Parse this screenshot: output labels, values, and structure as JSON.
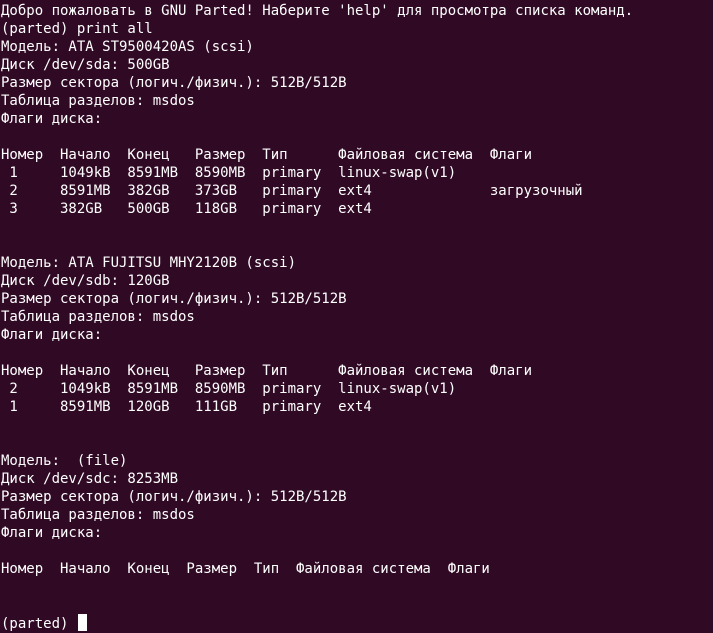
{
  "window": {
    "background": "#300a24",
    "foreground": "#ffffff"
  },
  "terminal": {
    "lines": [
      "Добро пожаловать в GNU Parted! Наберите 'help' для просмотра списка команд.",
      "(parted) print all",
      "Модель: ATA ST9500420AS (scsi)",
      "Диск /dev/sda: 500GB",
      "Размер сектора (логич./физич.): 512B/512B",
      "Таблица разделов: msdos",
      "Флаги диска:",
      "",
      "Номер  Начало  Конец   Размер  Тип      Файловая система  Флаги",
      " 1     1049kB  8591MB  8590MB  primary  linux-swap(v1)",
      " 2     8591MB  382GB   373GB   primary  ext4              загрузочный",
      " 3     382GB   500GB   118GB   primary  ext4",
      "",
      "",
      "Модель: ATA FUJITSU MHY2120B (scsi)",
      "Диск /dev/sdb: 120GB",
      "Размер сектора (логич./физич.): 512B/512B",
      "Таблица разделов: msdos",
      "Флаги диска:",
      "",
      "Номер  Начало  Конец   Размер  Тип      Файловая система  Флаги",
      " 2     1049kB  8591MB  8590MB  primary  linux-swap(v1)",
      " 1     8591MB  120GB   111GB   primary  ext4",
      "",
      "",
      "Модель:  (file)",
      "Диск /dev/sdc: 8253MB",
      "Размер сектора (логич./физич.): 512B/512B",
      "Таблица разделов: msdos",
      "Флаги диска:",
      "",
      "Номер  Начало  Конец  Размер  Тип  Файловая система  Флаги",
      "",
      "",
      "(parted) "
    ]
  }
}
